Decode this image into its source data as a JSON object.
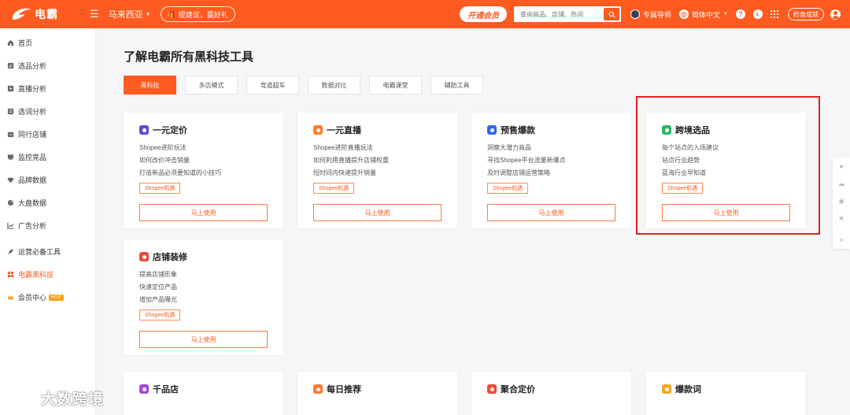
{
  "topbar": {
    "logo_text": "电霸",
    "region": "马来西亚",
    "tip": "提建议，赢好礼",
    "vip": "开通会员",
    "search_placeholder": "查询商品、店铺、热词",
    "advisor": "专属导师",
    "language": "简体中文",
    "badge": "终身成就"
  },
  "sidebar": {
    "items": [
      {
        "label": "首页",
        "icon": "home-icon"
      },
      {
        "label": "选品分析",
        "icon": "chart-icon"
      },
      {
        "label": "直播分析",
        "icon": "play-icon"
      },
      {
        "label": "选词分析",
        "icon": "list-icon"
      },
      {
        "label": "同行店铺",
        "icon": "shop-icon"
      },
      {
        "label": "监控竞品",
        "icon": "monitor-icon"
      },
      {
        "label": "品牌数据",
        "icon": "diamond-icon"
      },
      {
        "label": "大盘数据",
        "icon": "pie-icon"
      },
      {
        "label": "广告分析",
        "icon": "trend-icon"
      },
      {
        "label": "运营必备工具",
        "icon": "rocket-icon"
      },
      {
        "label": "电霸黑科技",
        "icon": "apps-icon"
      },
      {
        "label": "会员中心",
        "icon": "crown-icon",
        "badge": "HOT"
      }
    ]
  },
  "main": {
    "title": "了解电霸所有黑科技工具",
    "tabs": [
      "黑科技",
      "多店模式",
      "弯道超车",
      "数据对比",
      "电霸课堂",
      "辅助工具"
    ],
    "cards": [
      {
        "title": "一元定价",
        "color": "#5b4bd6",
        "lines": [
          "Shopee进阶玩法",
          "如何改价冲击销量",
          "打造新品必须要知道的小技巧"
        ],
        "tag": "Shopee机遇",
        "button": "马上使用"
      },
      {
        "title": "一元直播",
        "color": "#ff7a2e",
        "lines": [
          "Shopee进阶直播玩法",
          "如何利用直播提升店铺权重",
          "短时间内快速提升销量"
        ],
        "tag": "Shopee机遇",
        "button": "马上使用"
      },
      {
        "title": "预售爆款",
        "color": "#3366e6",
        "lines": [
          "洞察大潜力商品",
          "寻找Shopee平台流量新爆点",
          "及时调整店铺运营策略"
        ],
        "tag": "Shopee机遇",
        "button": "马上使用"
      },
      {
        "title": "跨境选品",
        "color": "#2fb56a",
        "lines": [
          "每个站点的入场建议",
          "站点行业趋势",
          "蓝海行业早知道"
        ],
        "tag": "Shopee机遇",
        "button": "马上使用"
      },
      {
        "title": "店铺装修",
        "color": "#f04a3a",
        "lines": [
          "提高店铺形象",
          "快速定位产品",
          "增加产品曝光"
        ],
        "tag": "Shopee机遇",
        "button": "马上使用"
      }
    ],
    "partial_cards": [
      {
        "title": "千品店",
        "color": "#a24bd6"
      },
      {
        "title": "每日推荐",
        "color": "#ff7a2e"
      },
      {
        "title": "聚合定价",
        "color": "#f04a3a"
      },
      {
        "title": "爆款词",
        "color": "#f5a623"
      }
    ]
  },
  "watermark": "大数跨境"
}
